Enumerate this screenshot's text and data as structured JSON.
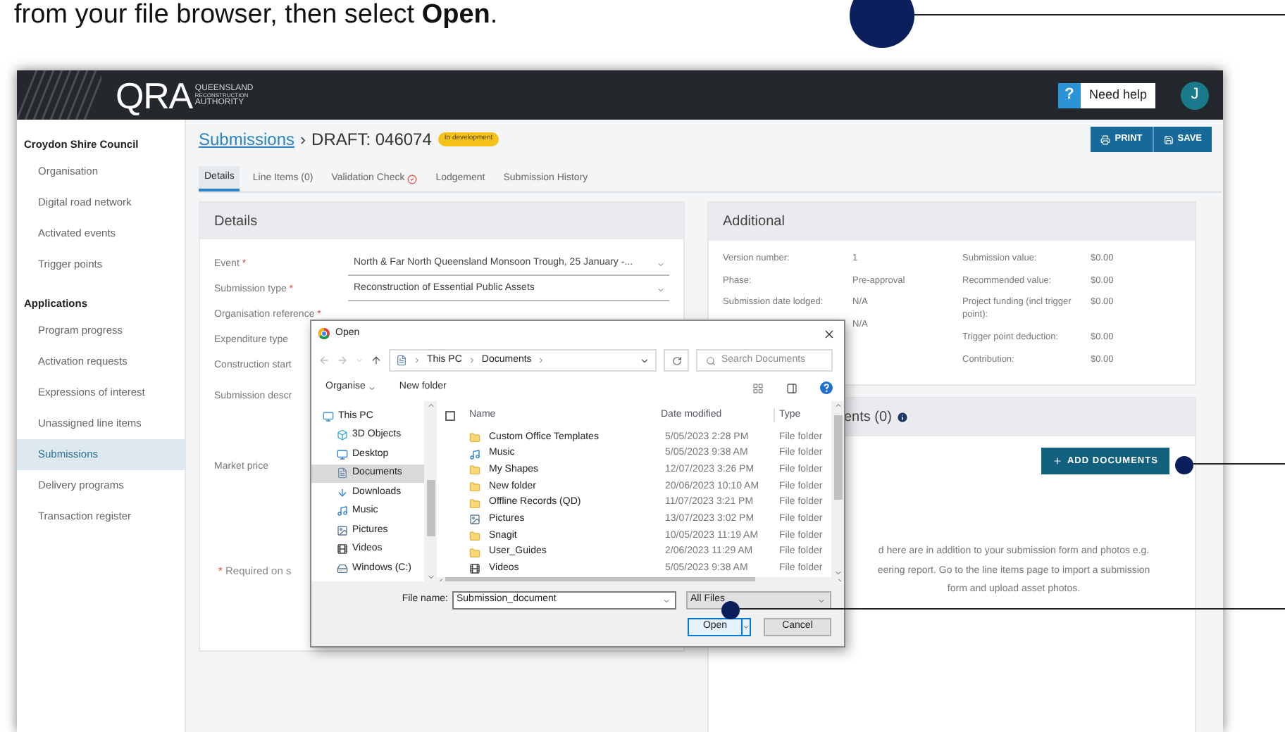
{
  "instruction": "from your file browser, then select **Open**.",
  "header": {
    "logo": "QRA",
    "logo_subtitle": [
      "QUEENSLAND",
      "RECONSTRUCTION",
      "AUTHORITY"
    ],
    "help_icon": "?",
    "help": "Need help",
    "avatar": "J"
  },
  "sidebar": {
    "sections": [
      {
        "title": "Croydon Shire Council",
        "items": [
          {
            "label": "Organisation",
            "selected": false
          },
          {
            "label": "Digital road network",
            "selected": false
          },
          {
            "label": "Activated events",
            "selected": false
          },
          {
            "label": "Trigger points",
            "selected": false
          }
        ]
      },
      {
        "title": "Applications",
        "items": [
          {
            "label": "Program progress",
            "selected": false
          },
          {
            "label": "Activation requests",
            "selected": false
          },
          {
            "label": "Expressions of interest",
            "selected": false
          },
          {
            "label": "Unassigned line items",
            "selected": false
          },
          {
            "label": "Submissions",
            "selected": true
          },
          {
            "label": "Delivery programs",
            "selected": false
          },
          {
            "label": "Transaction register",
            "selected": false
          }
        ]
      }
    ]
  },
  "breadcrumb": {
    "link": "Submissions",
    "separator": "›",
    "current": "DRAFT: 046074",
    "badge": "In development"
  },
  "actions": [
    {
      "label": "PRINT",
      "kind": "print"
    },
    {
      "label": "SAVE",
      "kind": "save"
    }
  ],
  "tabs": [
    {
      "label": "Details",
      "selected": true,
      "kind": "plain"
    },
    {
      "label": "Line Items (0)",
      "selected": false,
      "kind": "plain"
    },
    {
      "label": "Validation Check",
      "selected": false,
      "kind": "check"
    },
    {
      "label": "Lodgement",
      "selected": false,
      "kind": "plain"
    },
    {
      "label": "Submission History",
      "selected": false,
      "kind": "plain"
    }
  ],
  "details": {
    "title": "Details",
    "fields": [
      {
        "label": "Event",
        "required": true,
        "kind": "select",
        "value": "North & Far North Queensland Monsoon Trough, 25 January -..."
      },
      {
        "label": "Submission type",
        "required": true,
        "kind": "select",
        "value": "Reconstruction of Essential Public Assets"
      },
      {
        "label": "Organisation reference",
        "required": true,
        "kind": "text"
      },
      {
        "label": "Expenditure type",
        "required": false,
        "kind": "text"
      },
      {
        "label": "Construction start",
        "required": false,
        "kind": "text"
      },
      {
        "label": "Submission descr",
        "required": false,
        "kind": "textarea"
      },
      {
        "label": "Market price",
        "required": false,
        "kind": "text"
      }
    ],
    "required_mark": "*",
    "footnote": "* Required on s"
  },
  "additional": {
    "title": "Additional",
    "left": [
      {
        "label": "Version number:",
        "value": "1"
      },
      {
        "label": "Phase:",
        "value": "Pre-approval"
      },
      {
        "label": "Submission date lodged:",
        "value": "N/A"
      },
      {
        "value": "N/A"
      }
    ],
    "right": [
      {
        "label": "Submission value:",
        "value": "$0.00"
      },
      {
        "label": "Recommended value:",
        "value": "$0.00"
      },
      {
        "label": "Project funding (incl trigger point):",
        "value": "$0.00"
      },
      {
        "label": "Trigger point deduction:",
        "value": "$0.00"
      },
      {
        "label": "Contribution:",
        "value": "$0.00"
      }
    ]
  },
  "documents": {
    "title": "ents (0)",
    "button": "ADD DOCUMENTS",
    "note_lines": [
      "d here are in addition to your submission form and photos e.g.",
      "eering report. Go to the line items page to import a submission",
      "form and upload asset photos."
    ]
  },
  "dialog": {
    "title": "Open",
    "path": [
      "This PC",
      "Documents"
    ],
    "search_placeholder": "Search Documents",
    "organise": "Organise",
    "new_folder": "New folder",
    "tree": [
      {
        "label": "This PC",
        "kind": "pc",
        "selected": false,
        "children": [
          {
            "label": "3D Objects",
            "kind": "objects",
            "selected": false
          },
          {
            "label": "Desktop",
            "kind": "desktop",
            "selected": false
          },
          {
            "label": "Documents",
            "kind": "documents",
            "selected": true
          },
          {
            "label": "Downloads",
            "kind": "downloads",
            "selected": false
          },
          {
            "label": "Music",
            "kind": "music",
            "selected": false
          },
          {
            "label": "Pictures",
            "kind": "pictures",
            "selected": false
          },
          {
            "label": "Videos",
            "kind": "videos",
            "selected": false
          },
          {
            "label": "Windows (C:)",
            "kind": "drive",
            "selected": false
          }
        ]
      }
    ],
    "select_all_checked": false,
    "columns": [
      "Name",
      "Date modified",
      "Type"
    ],
    "files": [
      {
        "name": "Custom Office Templates",
        "date": "5/05/2023 2:28 PM",
        "type": "File folder",
        "kind": "folder"
      },
      {
        "name": "Music",
        "date": "5/05/2023 9:38 AM",
        "type": "File folder",
        "kind": "music"
      },
      {
        "name": "My Shapes",
        "date": "12/07/2023 3:26 PM",
        "type": "File folder",
        "kind": "folder"
      },
      {
        "name": "New folder",
        "date": "20/06/2023 10:10 AM",
        "type": "File folder",
        "kind": "folder"
      },
      {
        "name": "Offline Records (QD)",
        "date": "11/07/2023 3:21 PM",
        "type": "File folder",
        "kind": "folder"
      },
      {
        "name": "Pictures",
        "date": "13/07/2023 3:02 PM",
        "type": "File folder",
        "kind": "pictures"
      },
      {
        "name": "Snagit",
        "date": "10/05/2023 11:19 AM",
        "type": "File folder",
        "kind": "folder"
      },
      {
        "name": "User_Guides",
        "date": "2/06/2023 11:29 AM",
        "type": "File folder",
        "kind": "folder"
      },
      {
        "name": "Videos",
        "date": "5/05/2023 9:38 AM",
        "type": "File folder",
        "kind": "videos"
      }
    ],
    "file_name_label": "File name:",
    "file_name": "Submission_document",
    "filter": "All Files",
    "open": "Open",
    "cancel": "Cancel"
  }
}
